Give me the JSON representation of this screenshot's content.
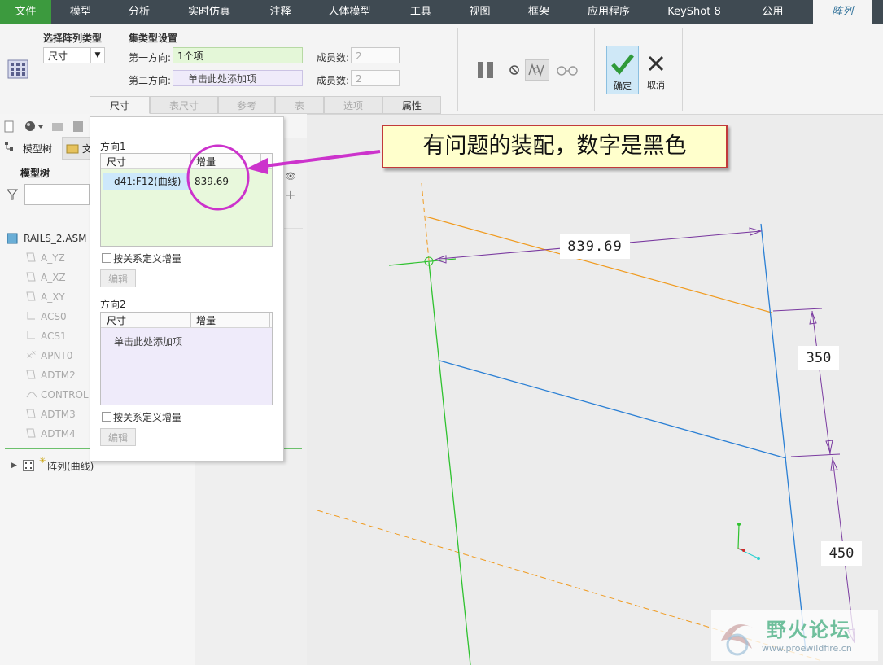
{
  "menubar": {
    "items": [
      "文件",
      "模型",
      "分析",
      "实时仿真",
      "注释",
      "人体模型",
      "工具",
      "视图",
      "框架",
      "应用程序",
      "KeyShot 8",
      "公用",
      "阵列"
    ]
  },
  "ribbon": {
    "pattern_type_label": "选择阵列类型",
    "pattern_type_value": "尺寸",
    "set_type_label": "集类型设置",
    "dir1_label": "第一方向:",
    "dir1_value": "1个项",
    "dir2_label": "第二方向:",
    "dir2_value": "单击此处添加项",
    "members_label": "成员数:",
    "members1": "2",
    "members2": "2",
    "ok_label": "确定",
    "cancel_label": "取消",
    "tabs": [
      "尺寸",
      "表尺寸",
      "参考",
      "表",
      "选项",
      "属性"
    ]
  },
  "tree": {
    "tab_model": "模型树",
    "tab_file": "文",
    "heading": "模型树",
    "root": "RAILS_2.ASM",
    "items": [
      "A_YZ",
      "A_XZ",
      "A_XY",
      "ACS0",
      "ACS1",
      "APNT0",
      "ADTM2",
      "CONTROL_",
      "ADTM3",
      "ADTM4"
    ],
    "pattern_item": "阵列(曲线)"
  },
  "popup": {
    "dir1_title": "方向1",
    "col_dim": "尺寸",
    "col_inc": "增量",
    "row_dim": "d41:F12(曲线)",
    "row_inc": "839.69",
    "relation_label": "按关系定义增量",
    "edit_label": "编辑",
    "dir2_title": "方向2",
    "dir2_placeholder": "单击此处添加项"
  },
  "callout": {
    "text": "有问题的装配，数字是黑色"
  },
  "viewport": {
    "dim_main": "839.69",
    "dim_350": "350",
    "dim_450": "450"
  },
  "watermark": {
    "name": "野火论坛",
    "url": "www.proewildfire.cn"
  },
  "colors": {
    "accent_green": "#3c9a3e",
    "menubar": "#3f4a52",
    "callout_border": "#c23a3a",
    "callout_bg": "#ffffcc",
    "highlight": "#cc33cc"
  }
}
